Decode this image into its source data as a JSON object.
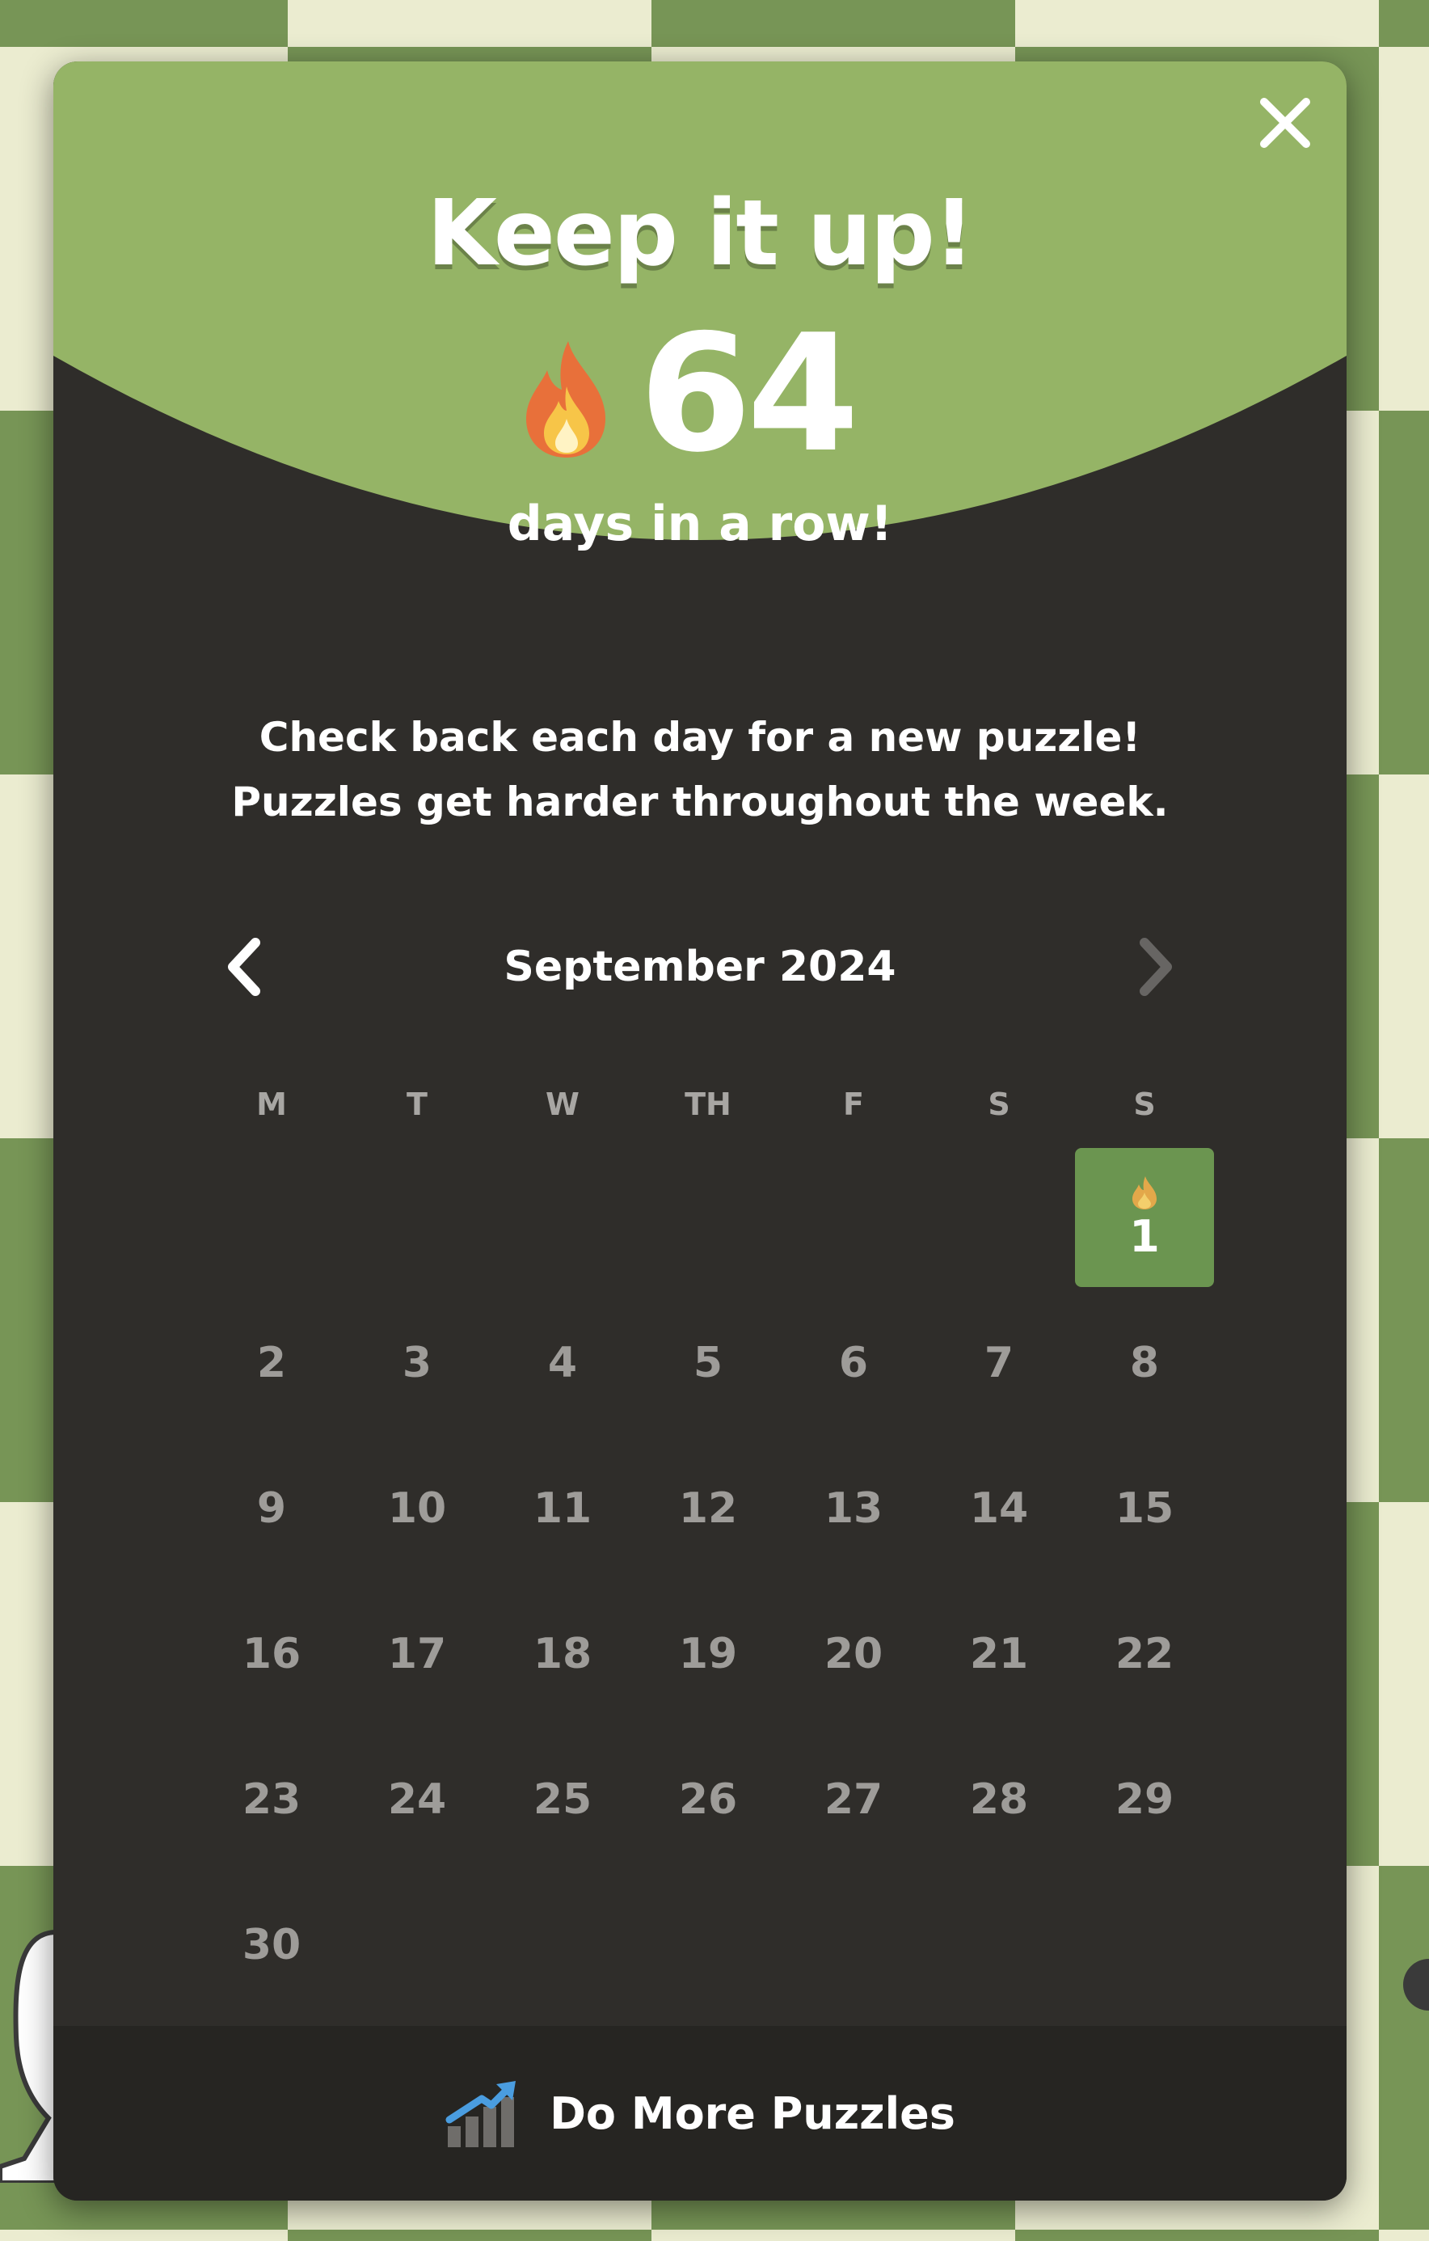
{
  "modal": {
    "title": "Keep it up!",
    "streak_count": "64",
    "streak_label": "days in a row!",
    "message_line1": "Check back each day for a new puzzle!",
    "message_line2": "Puzzles get harder throughout the week."
  },
  "calendar": {
    "month_label": "September 2024",
    "weekdays": [
      "M",
      "T",
      "W",
      "TH",
      "F",
      "S",
      "S"
    ],
    "completed_day": "1",
    "days": [
      "2",
      "3",
      "4",
      "5",
      "6",
      "7",
      "8",
      "9",
      "10",
      "11",
      "12",
      "13",
      "14",
      "15",
      "16",
      "17",
      "18",
      "19",
      "20",
      "21",
      "22",
      "23",
      "24",
      "25",
      "26",
      "27",
      "28",
      "29",
      "30"
    ]
  },
  "footer": {
    "label": "Do More Puzzles"
  },
  "colors": {
    "header_green": "#95b466",
    "modal_bg": "#2f2d2a",
    "footer_bg": "#262522",
    "completed_day_bg": "#6b9550",
    "board_dark": "#779556",
    "board_light": "#ebecd0"
  },
  "icons": {
    "close": "close-icon",
    "flame": "flame-icon",
    "prev": "chevron-left-icon",
    "next": "chevron-right-icon",
    "puzzles": "chart-up-icon"
  }
}
